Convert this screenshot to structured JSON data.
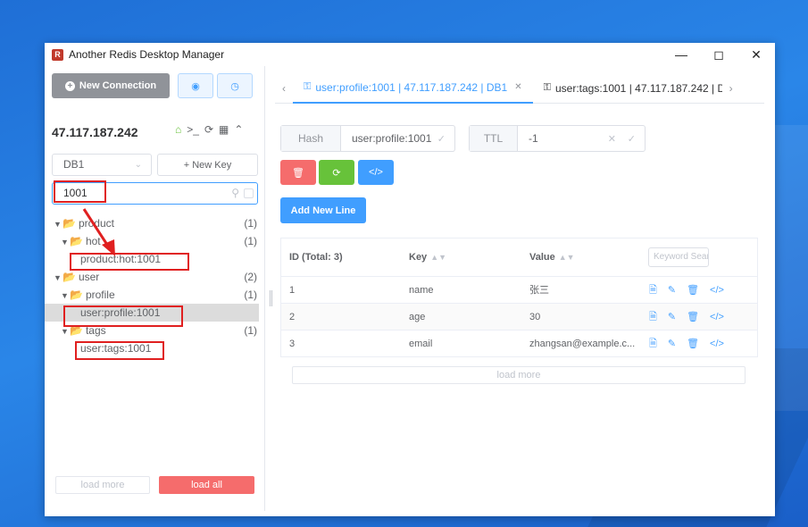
{
  "window": {
    "title": "Another Redis Desktop Manager"
  },
  "left": {
    "new_connection": "New Connection",
    "host": "47.117.187.242",
    "db_select": "DB1",
    "new_key": "+ New Key",
    "search_value": "1001",
    "tree": [
      {
        "label": "product",
        "count": "(1)"
      },
      {
        "label": "hot",
        "count": "(1)"
      },
      {
        "label": "product:hot:1001"
      },
      {
        "label": "user",
        "count": "(2)"
      },
      {
        "label": "profile",
        "count": "(1)"
      },
      {
        "label": "user:profile:1001"
      },
      {
        "label": "tags",
        "count": "(1)"
      },
      {
        "label": "user:tags:1001"
      }
    ],
    "load_more": "load more",
    "load_all": "load all"
  },
  "tabs": [
    {
      "label": "user:profile:1001 | 47.117.187.242 | DB1"
    },
    {
      "label": "user:tags:1001 | 47.117.187.242 | D"
    }
  ],
  "key": {
    "type_label": "Hash",
    "name": "user:profile:1001",
    "ttl_label": "TTL",
    "ttl_value": "-1"
  },
  "add_new_line": "Add New Line",
  "table": {
    "headers": {
      "id": "ID (Total: 3)",
      "key": "Key",
      "value": "Value"
    },
    "keyword_placeholder": "Keyword Search",
    "rows": [
      {
        "id": "1",
        "key": "name",
        "value": "张三"
      },
      {
        "id": "2",
        "key": "age",
        "value": "30"
      },
      {
        "id": "3",
        "key": "email",
        "value": "zhangsan@example.c..."
      }
    ],
    "load_more": "load more"
  },
  "colors": {
    "primary": "#409eff",
    "danger": "#f56c6c",
    "success": "#67c23a",
    "annotation": "#e02020"
  }
}
